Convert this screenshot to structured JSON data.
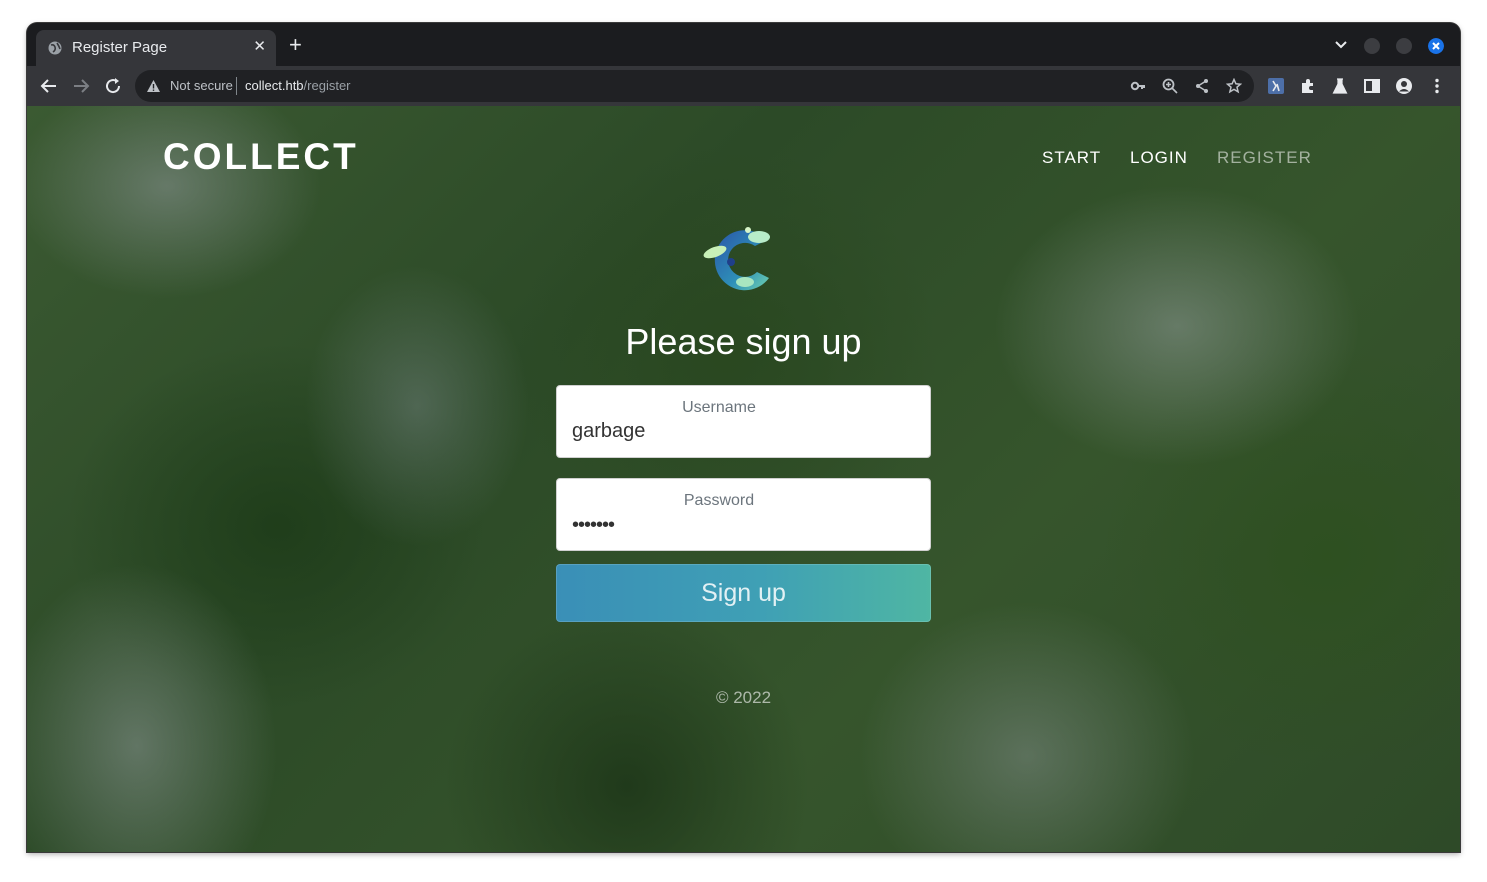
{
  "browser": {
    "tab_title": "Register Page",
    "tab_close": "✕",
    "new_tab": "+",
    "security_label": "Not secure",
    "url_host": "collect.htb",
    "url_path": "/register",
    "close_color": "#1a73e8"
  },
  "header": {
    "brand": "COLLECT",
    "nav": [
      {
        "label": "START"
      },
      {
        "label": "LOGIN"
      },
      {
        "label": "REGISTER"
      }
    ]
  },
  "form": {
    "heading": "Please sign up",
    "username_label": "Username",
    "username_value": "garbage",
    "password_label": "Password",
    "password_value": "•••••••",
    "submit_label": "Sign up"
  },
  "footer": {
    "copyright": "© 2022"
  }
}
